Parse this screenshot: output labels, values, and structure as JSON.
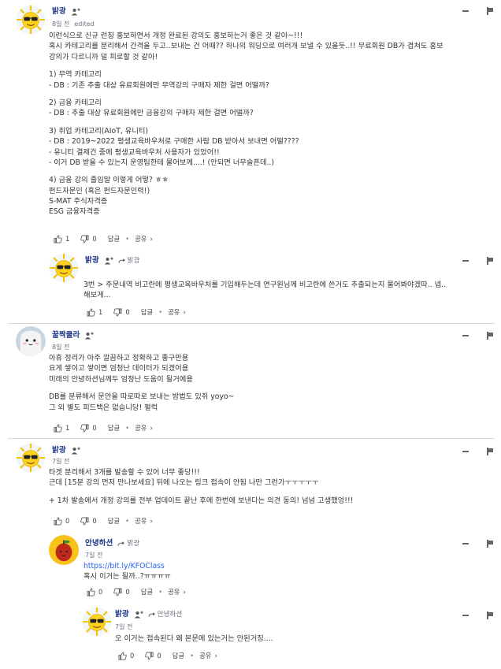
{
  "comments": [
    {
      "author": "밝광",
      "time": "8일 전",
      "edited": "edited",
      "lines": [
        "이런식으로 신규 런칭 홍보하면서 개정 완료된 강의도 홍보하는거 좋은 것 같아~!!!",
        "혹시 카테고리를 분리해서 간격을 두고..보내는 건 어때?? 하나의 워딩으로 여러개 보낼 수 있을듯..!! 무료회원 DB가 겹쳐도 홍보",
        "강의가 다르니까 덜 피로할 것 같아!",
        "",
        "1) 무역 카테고리",
        "- DB : 기존 추출 대상 유료회원에만 무역강의 구매자 제한 걸면 어떨까?",
        "",
        "2) 금융 카테고리",
        "- DB : 추출 대상 유료회원에만 금융강의 구매자 제한 걸면 어떨까?",
        "",
        "3) 취업 카테고리(AIoT, 유니티)",
        "- DB : 2019~2022 평생교육바우처로 구매한 사람 DB 받아서 보내면 어떨????",
        "- 유니티 결제건 중에 평생교육바우처 사용자가 있었어!!",
        "- 이거 DB 받을 수 있는지 운영팀한테 물어보께....! (안되면 너무슬픈데..)",
        "",
        "4) 금융 강의 줄임말 이렇게 어떻? ㅎㅎ",
        "펀드자문인 (혹은 펀드자문인력!)",
        "S-MAT 주식자격증",
        "ESG 금융자격증"
      ],
      "likes": "1",
      "dislikes": "0",
      "reply": "답글",
      "share": "공유"
    },
    {
      "author": "밝광",
      "mention": "밝광",
      "lines": [
        "3번 > 주문내역 비고란에 평생교육바우처를 기입해두는데 연구원님께 비고란에 쓴거도 추출되는지 물어봐야겠따.. 넵..",
        "해보게..."
      ],
      "likes": "1",
      "dislikes": "0",
      "reply": "답글",
      "share": "공유"
    },
    {
      "author": "꿀짝쿨라",
      "time": "8일 전",
      "lines": [
        "아휴 정리가 아주 깔끔하고 정확하고 좋구만용",
        "요게 쌓이고 쌓이면 엄청난 데이터가 되겠어용",
        "미래의 안녕하션님께두 엄청난 도움이 될거에용",
        "",
        "DB를 분류해서 문안을 따로따로 보내는 방법도 있쥐 yoyo~",
        "그 외 별도 피드백은 없습니당! 펄럭"
      ],
      "likes": "1",
      "dislikes": "0",
      "reply": "답글",
      "share": "공유"
    },
    {
      "author": "밝광",
      "time": "7일 전",
      "lines": [
        "타겟 분리해서 3개를 발송할 수 있어 너무 좋당!!!",
        "근데 [15분 강의 먼저 만나보세요] 뒤에 나오는 링크 접속이 안됨 나만 그런가ㅜㅜㅜㅜㅜ",
        "",
        "+ 1차 발송에서 개정 강의를 전부 업데이트 끝난 후에 한번에 보낸다는 의견 동의! 넘넘 고생했엉!!!"
      ],
      "likes": "0",
      "dislikes": "0",
      "reply": "답글",
      "share": "공유"
    },
    {
      "author": "안녕하션",
      "mention": "밝광",
      "time": "7일 전",
      "link": "https://bit.ly/KFOClass",
      "lines": [
        "혹시 이거는 될까..?ㅠㅠㅠㅠ"
      ],
      "likes": "0",
      "dislikes": "0",
      "reply": "답글",
      "share": "공유"
    },
    {
      "author": "밝광",
      "mention": "안녕하션",
      "time": "7일 전",
      "lines": [
        "오 이거는 접속된다 왜 본문에 있는거는 안된거징...."
      ],
      "likes": "0",
      "dislikes": "0",
      "reply": "답글",
      "share": "공유"
    }
  ],
  "colors": {
    "author": "#1e3a8a",
    "link": "#2563eb",
    "divider": "#d9d9d9"
  },
  "icons": [
    "sunglasses-sun-avatar",
    "ghost-avatar",
    "apple-avatar",
    "add-user-icon",
    "reply-arrow-icon",
    "thumb-up-icon",
    "thumb-down-icon",
    "collapse-icon",
    "flag-icon",
    "chevron-right-icon"
  ]
}
